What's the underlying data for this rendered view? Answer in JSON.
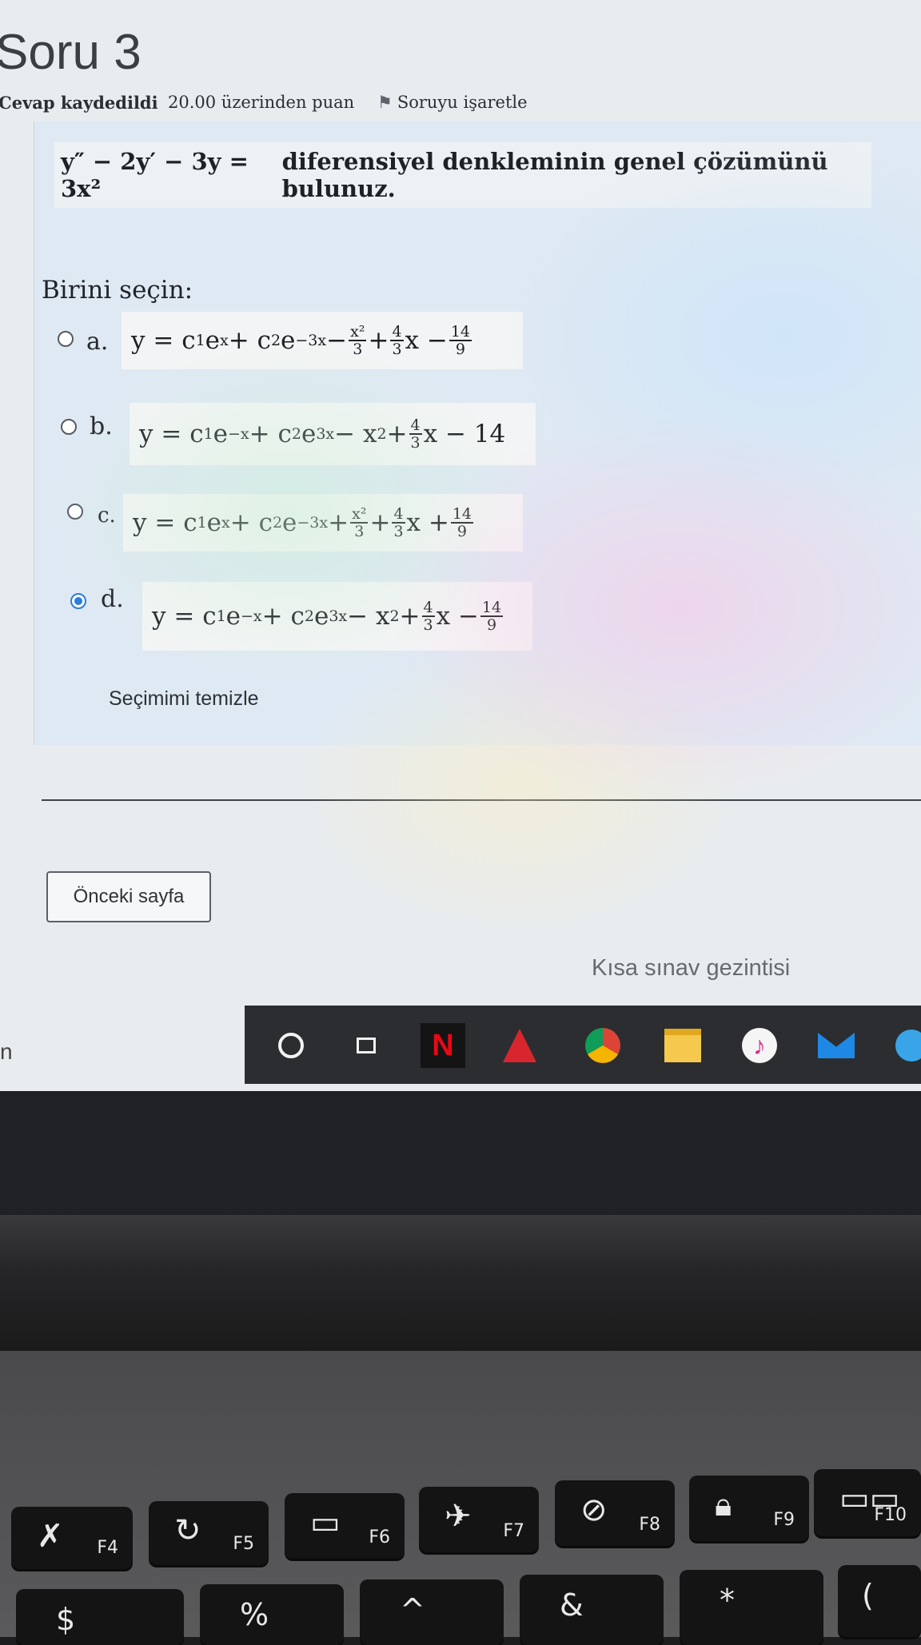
{
  "page": {
    "title": "Soru 3",
    "status": "Cevap kaydedildi",
    "points": "20.00 üzerinden puan",
    "flag_label": "Soruyu işaretle"
  },
  "question": {
    "equation": "y″ − 2y′ − 3y = 3x²",
    "text": "diferensiyel denkleminin genel çözümünü bulunuz."
  },
  "prompt": "Birini seçin:",
  "options": [
    {
      "letter": "a.",
      "selected": false
    },
    {
      "letter": "b.",
      "selected": false
    },
    {
      "letter": "c.",
      "selected": false
    },
    {
      "letter": "d.",
      "selected": true
    }
  ],
  "option_formulas": {
    "a": {
      "lhs": "y = c",
      "s1": "1",
      "e1": "e",
      "p1": "x",
      "plus1": " + c",
      "s2": "2",
      "e2": "e",
      "p2": "−3x",
      "t1": " − ",
      "f1n": "x²",
      "f1d": "3",
      "t2": " + ",
      "f2n": "4",
      "f2d": "3",
      "t3": "x − ",
      "f3n": "14",
      "f3d": "9"
    },
    "b": {
      "lhs": "y = c",
      "s1": "1",
      "e1": "e",
      "p1": "−x",
      "plus1": " + c",
      "s2": "2",
      "e2": "e",
      "p2": "3x",
      "t1": " − x",
      "sq": "2",
      "t2": " + ",
      "f2n": "4",
      "f2d": "3",
      "t3": "x − 14"
    },
    "c": {
      "lhs": "y = c",
      "s1": "1",
      "e1": "e",
      "p1": "x",
      "plus1": " + c",
      "s2": "2",
      "e2": "e",
      "p2": "−3x",
      "t1": " + ",
      "f1n": "x²",
      "f1d": "3",
      "t2": " + ",
      "f2n": "4",
      "f2d": "3",
      "t3": "x + ",
      "f3n": "14",
      "f3d": "9"
    },
    "d": {
      "lhs": "y = c",
      "s1": "1",
      "e1": "e",
      "p1": "−x",
      "plus1": " + c",
      "s2": "2",
      "e2": "e",
      "p2": "3x",
      "t1": " − x",
      "sq": "2",
      "t2": " + ",
      "f2n": "4",
      "f2d": "3",
      "t3": "x − ",
      "f3n": "14",
      "f3d": "9"
    }
  },
  "clear_label": "Seçimimi temizle",
  "prev_button": "Önceki sayfa",
  "nav_label": "Kısa sınav gezintisi",
  "left_edge_text": "n",
  "keyboard": {
    "fkeys": [
      "F4",
      "F5",
      "F6",
      "F7",
      "F8",
      "F9",
      "F10"
    ],
    "row2": [
      "$",
      "%",
      "^",
      "&",
      "*",
      "("
    ]
  },
  "colors": {
    "accent": "#2a7de1",
    "panel": "#dfe9f3",
    "netflix": "#e50914"
  },
  "icons": [
    "flag-icon",
    "cortana-icon",
    "task-view-icon",
    "netflix-icon",
    "acrobat-icon",
    "chrome-icon",
    "file-explorer-icon",
    "itunes-icon",
    "mail-icon",
    "edge-icon"
  ]
}
